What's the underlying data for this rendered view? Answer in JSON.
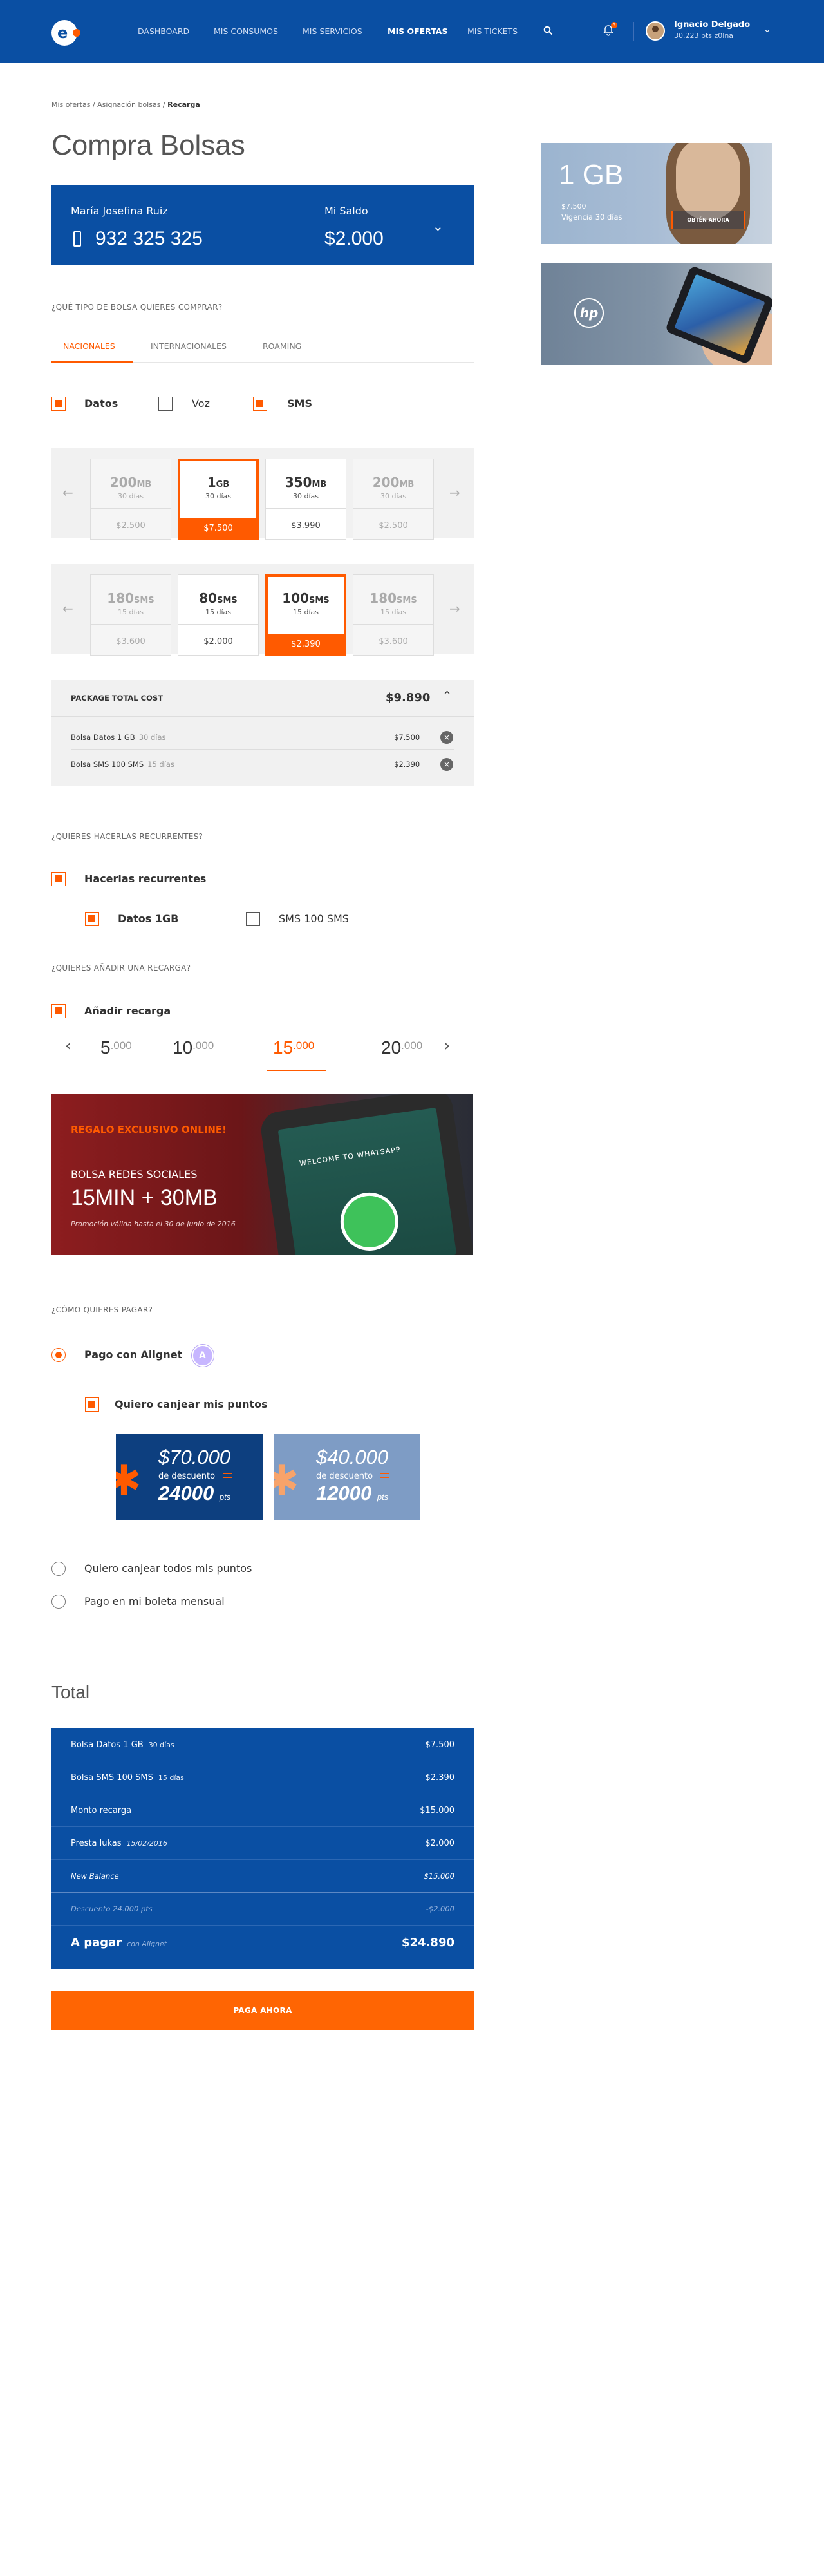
{
  "header": {
    "nav": [
      "DASHBOARD",
      "MIS CONSUMOS",
      "MIS SERVICIOS",
      "MIS OFERTAS",
      "MIS TICKETS"
    ],
    "active_nav": "MIS OFERTAS",
    "notification_count": "5",
    "user_name": "Ignacio Delgado",
    "user_points": "30.223 pts z0lna",
    "logo_letter": "e"
  },
  "breadcrumb": {
    "items": [
      "Mis ofertas",
      "Asignación bolsas",
      "Recarga"
    ],
    "sep": " / "
  },
  "page_title": "Compra Bolsas",
  "account": {
    "name_label": "María Josefina Ruiz",
    "phone": "932 325 325",
    "saldo_label": "Mi Saldo",
    "saldo": "$2.000"
  },
  "bag_type": {
    "question": "¿QUÉ TIPO DE BOLSA QUIERES COMPRAR?",
    "tabs": [
      "NACIONALES",
      "INTERNACIONALES",
      "ROAMING"
    ],
    "filters": [
      {
        "label": "Datos",
        "checked": true
      },
      {
        "label": "Voz",
        "checked": false
      },
      {
        "label": "SMS",
        "checked": true
      }
    ]
  },
  "data_cards": [
    {
      "value": "200",
      "unit": "MB",
      "days": "30 días",
      "price": "$2.500",
      "state": "disabled"
    },
    {
      "value": "1",
      "unit": "GB",
      "days": "30 días",
      "price": "$7.500",
      "state": "selected"
    },
    {
      "value": "350",
      "unit": "MB",
      "days": "30 días",
      "price": "$3.990",
      "state": "normal"
    },
    {
      "value": "200",
      "unit": "MB",
      "days": "30 días",
      "price": "$2.500",
      "state": "disabled"
    }
  ],
  "sms_cards": [
    {
      "value": "180",
      "unit": "SMS",
      "days": "15 días",
      "price": "$3.600",
      "state": "disabled"
    },
    {
      "value": "80",
      "unit": "SMS",
      "days": "15 días",
      "price": "$2.000",
      "state": "normal"
    },
    {
      "value": "100",
      "unit": "SMS",
      "days": "15 días",
      "price": "$2.390",
      "state": "selected"
    },
    {
      "value": "180",
      "unit": "SMS",
      "days": "15 días",
      "price": "$3.600",
      "state": "disabled"
    }
  ],
  "package": {
    "title": "PACKAGE TOTAL COST",
    "total": "$9.890",
    "items": [
      {
        "name": "Bolsa Datos 1 GB",
        "days": "30 días",
        "price": "$7.500"
      },
      {
        "name": "Bolsa SMS 100 SMS",
        "days": "15 días",
        "price": "$2.390"
      }
    ]
  },
  "recurring": {
    "question": "¿QUIERES HACERLAS RECURRENTES?",
    "main": {
      "label": "Hacerlas recurrentes",
      "checked": true
    },
    "subs": [
      {
        "label": "Datos 1GB",
        "checked": true
      },
      {
        "label": "SMS 100 SMS",
        "checked": false
      }
    ]
  },
  "recharge": {
    "question": "¿QUIERES AÑADIR UNA RECARGA?",
    "main": {
      "label": "Añadir recarga",
      "checked": true
    },
    "amounts": [
      {
        "main": "5",
        "sup": ".000"
      },
      {
        "main": "10",
        "sup": ".000"
      },
      {
        "main": "15",
        "sup": ".000",
        "selected": true
      },
      {
        "main": "20",
        "sup": ".000"
      }
    ]
  },
  "promo": {
    "kicker": "REGALO EXCLUSIVO ONLINE!",
    "name": "BOLSA REDES SOCIALES",
    "headline": "15MIN + 30MB",
    "legal": "Promoción válida hasta el 30 de junio de 2016",
    "phone_text": "WELCOME TO WHATSAPP"
  },
  "payment": {
    "question": "¿CÓMO QUIERES PAGAR?",
    "options": [
      {
        "label": "Pago con Alignet",
        "selected": true
      },
      {
        "label": "Quiero canjear todos mis puntos",
        "selected": false
      },
      {
        "label": "Pago en mi boleta mensual",
        "selected": false
      }
    ],
    "redeem": {
      "label": "Quiero canjear mis puntos",
      "checked": true
    },
    "discounts": [
      {
        "amount": "$70.000",
        "desc": "de descuento",
        "points": "24000",
        "pts_label": "pts",
        "color": "#0d3f7f",
        "selected": true
      },
      {
        "amount": "$40.000",
        "desc": "de descuento",
        "points": "12000",
        "pts_label": "pts",
        "color": "#7e9cc5",
        "selected": false
      }
    ]
  },
  "summary": {
    "title": "Total",
    "rows": [
      {
        "label": "Bolsa Datos 1 GB",
        "sub": "30 días",
        "value": "$7.500",
        "style": ""
      },
      {
        "label": "Bolsa SMS 100 SMS",
        "sub": "15 días",
        "value": "$2.390",
        "style": ""
      },
      {
        "label": "Monto recarga",
        "sub": "",
        "value": "$15.000",
        "style": ""
      },
      {
        "label": "Presta lukas",
        "sub": "15/02/2016",
        "value": "$2.000",
        "style": ""
      },
      {
        "label": "New Balance",
        "sub": "",
        "value": "$15.000",
        "style": "it"
      },
      {
        "label": "Descuento 24.000 pts",
        "sub": "",
        "value": "-$2.000",
        "style": "it muted"
      }
    ],
    "total_label": "A pagar",
    "total_sub": "con Alignet",
    "total_value": "$24.890"
  },
  "pay_button": "PAGA AHORA",
  "ads": {
    "ad1": {
      "gb": "1 GB",
      "price": "$7.500",
      "validity": "Vigencia 30 días",
      "cta": "OBTÉN AHORA"
    },
    "ad2": {
      "brand": "hp"
    }
  }
}
